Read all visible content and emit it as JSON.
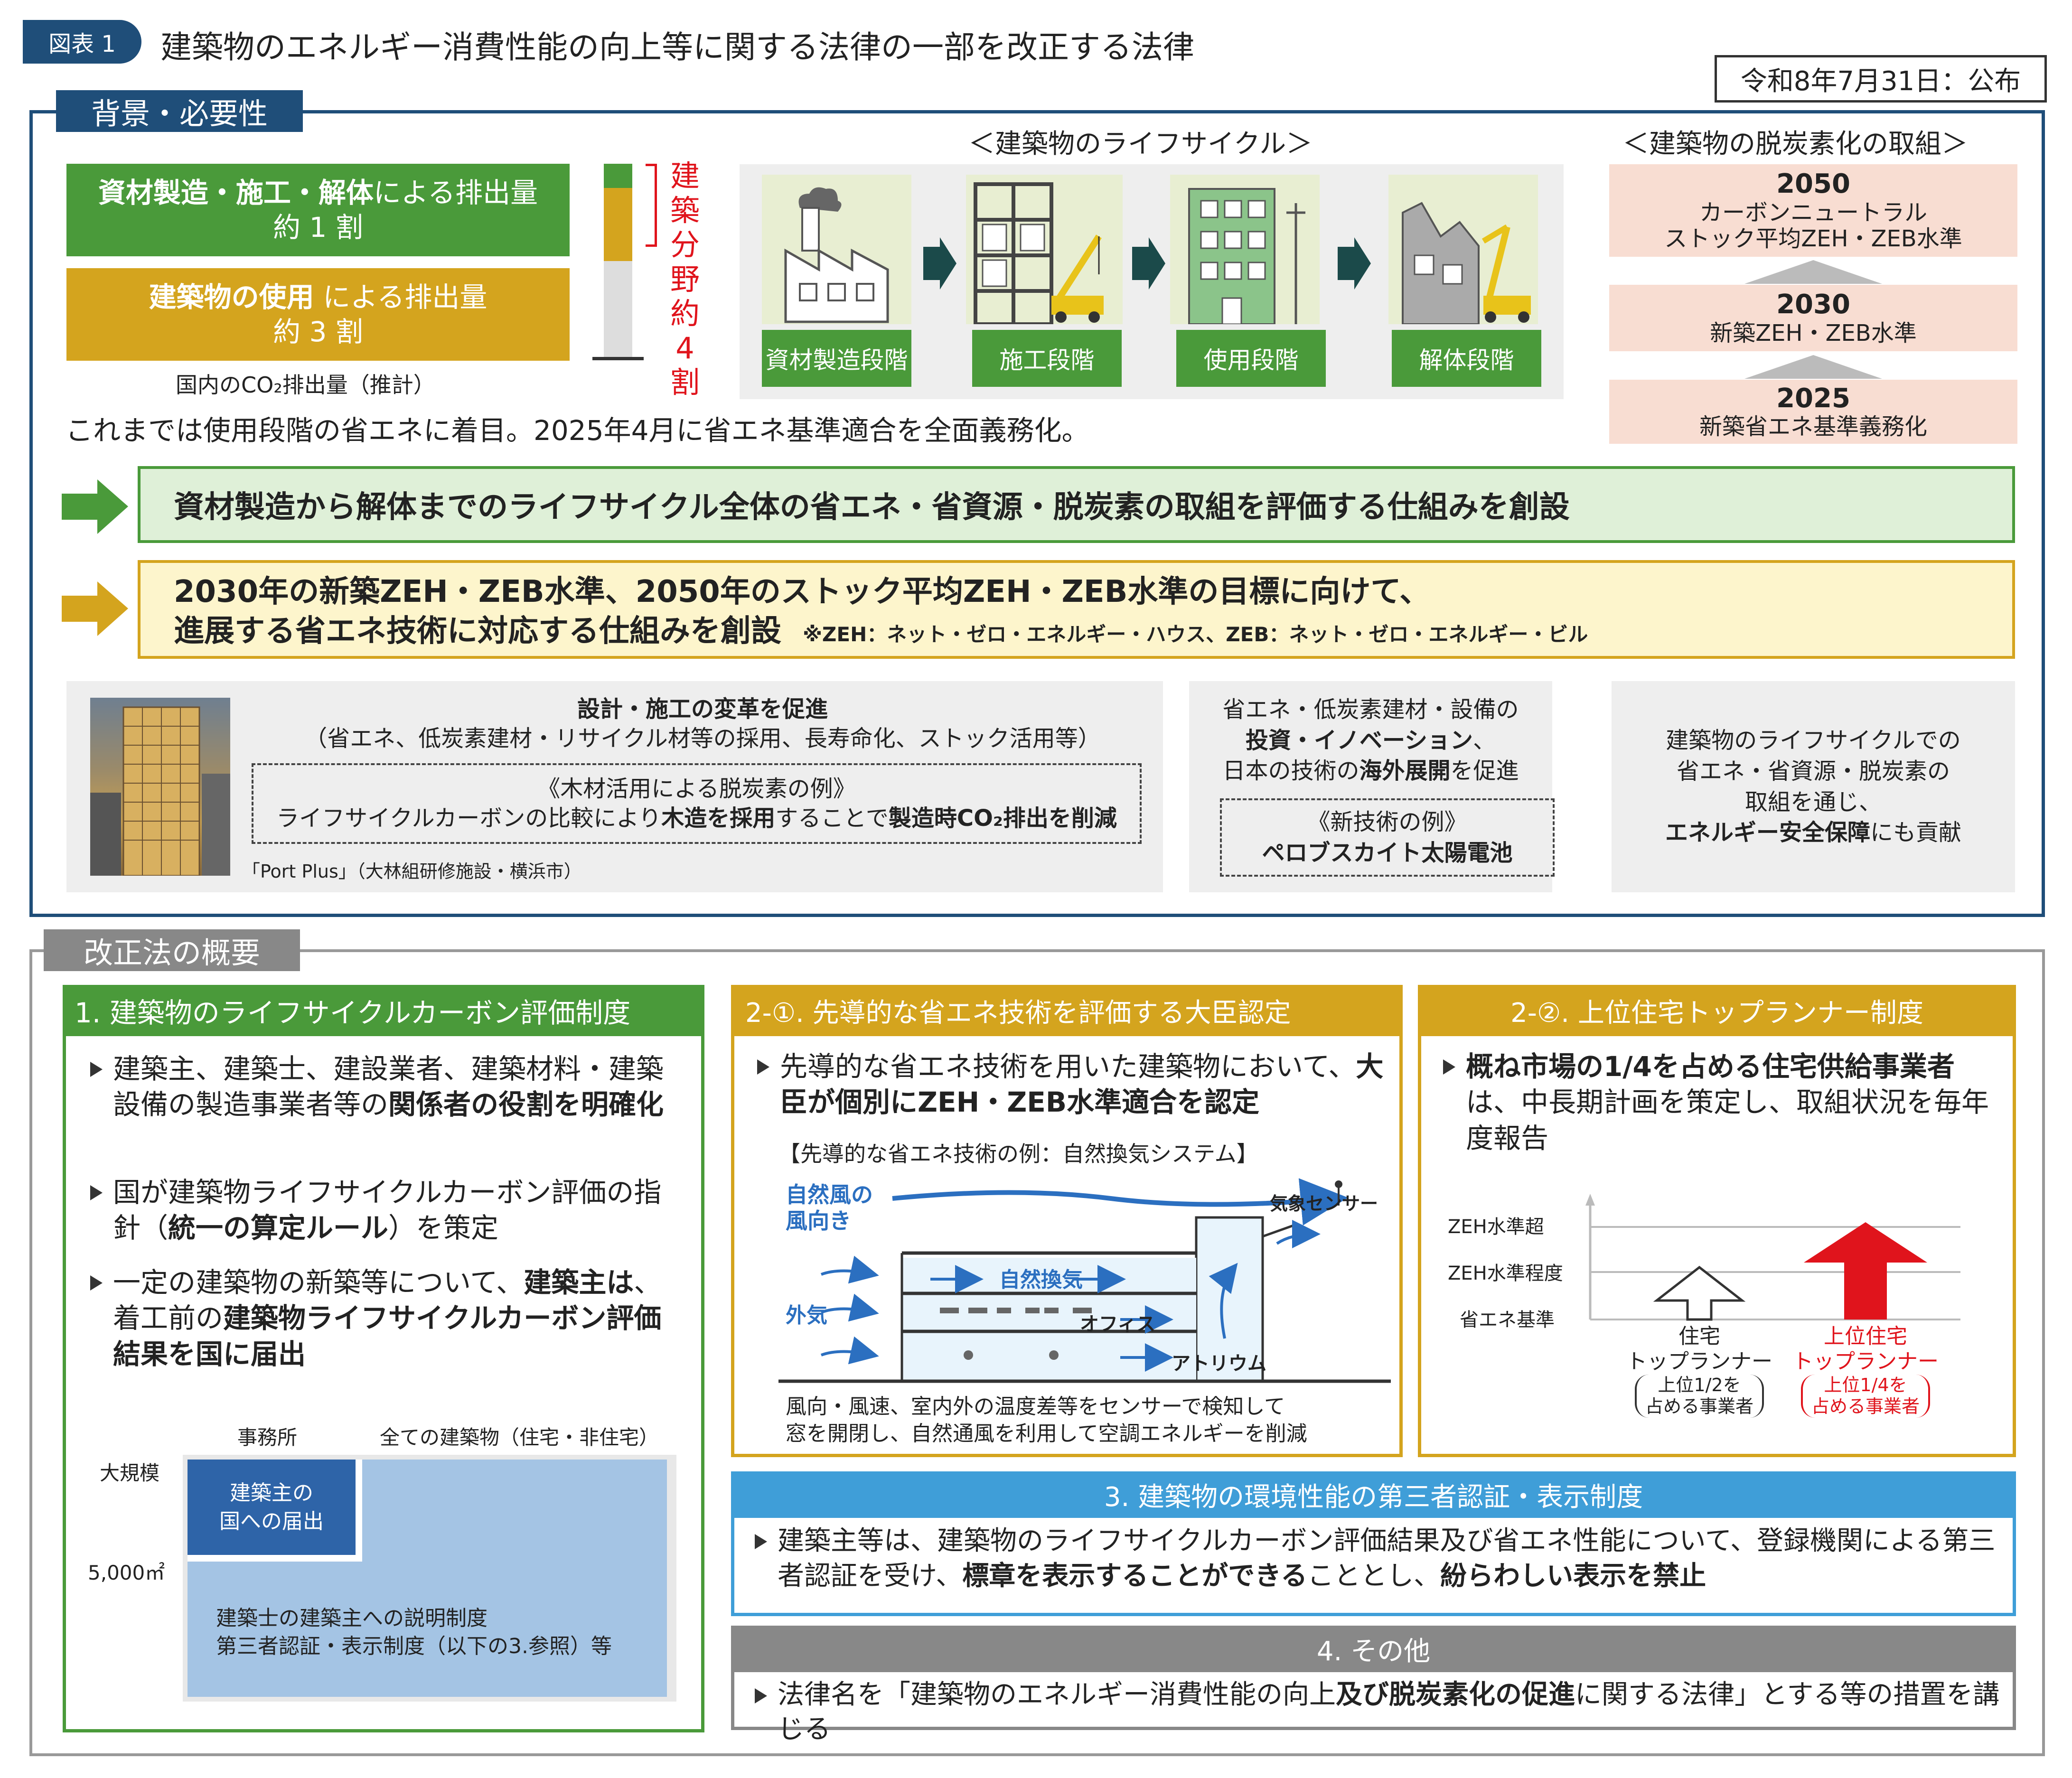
{
  "header": {
    "badge": "図表 1",
    "title": "建築物のエネルギー消費性能の向上等に関する法律の一部を改正する法律",
    "date": "令和8年7月31日：公布"
  },
  "background": {
    "section_label": "背景・必要性",
    "emission_1_a": "資材製造・施工・解体",
    "emission_1_b": "による排出量",
    "emission_1_c": "約 1 割",
    "emission_2_a": "建築物の使用",
    "emission_2_b": " による排出量",
    "emission_2_c": "約 3 割",
    "bar_caption": "国内のCO₂排出量（推計）",
    "vertical_label": "建築分野約4割",
    "bar_segments": {
      "green": 0.1,
      "yellow": 0.3
    },
    "lifecycle_title": "＜建築物のライフサイクル＞",
    "lifecycle_stages": [
      "資材製造段階",
      "施工段階",
      "使用段階",
      "解体段階"
    ],
    "decarb_title": "＜建築物の脱炭素化の取組＞",
    "decarb_2050_year": "2050",
    "decarb_2050_l1": "カーボンニュートラル",
    "decarb_2050_l2": "ストック平均ZEH・ZEB水準",
    "decarb_2030_year": "2030",
    "decarb_2030_l1": "新築ZEH・ZEB水準",
    "decarb_2025_year": "2025",
    "decarb_2025_l1": "新築省エネ基準義務化",
    "note": "これまでは使用段階の省エネに着目。2025年4月に省エネ基準適合を全面義務化。",
    "green_box": "資材製造から解体までのライフサイクル全体の省エネ・省資源・脱炭素の取組を評価する仕組みを創設",
    "yellow_box_l1": "2030年の新築ZEH・ZEB水準、2050年のストック平均ZEH・ZEB水準の目標に向けて、",
    "yellow_box_l2": "進展する省エネ技術に対応する仕組みを創設",
    "yellow_box_note": "※ZEH：ネット・ゼロ・エネルギー・ハウス、ZEB：ネット・ゼロ・エネルギー・ビル",
    "info1_title": "設計・施工の変革を促進",
    "info1_sub": "（省エネ、低炭素建材・リサイクル材等の採用、長寿命化、ストック活用等）",
    "info1_box_title": "《木材活用による脱炭素の例》",
    "info1_box_a": "ライフサイクルカーボンの比較により",
    "info1_box_b": "木造を採用",
    "info1_box_c": "することで",
    "info1_box_d": "製造時CO₂排出を削減",
    "photo_caption": "「Port Plus」（大林組研修施設・横浜市）",
    "info2_l1": "省エネ・低炭素建材・設備の",
    "info2_l2a": "投資・イノベーション",
    "info2_l2b": "、",
    "info2_l3a": "日本の技術の",
    "info2_l3b": "海外展開",
    "info2_l3c": "を促進",
    "info2_box_title": "《新技術の例》",
    "info2_box_body": "ペロブスカイト太陽電池",
    "info3_l1": "建築物のライフサイクルでの",
    "info3_l2": "省エネ・省資源・脱炭素の",
    "info3_l3": "取組を通じ、",
    "info3_l4a": "エネルギー安全保障",
    "info3_l4b": "にも貢献"
  },
  "overview": {
    "section_label": "改正法の概要",
    "s1_title": "1. 建築物のライフサイクルカーボン評価制度",
    "s1_b1_a": "建築主、建築士、建設業者、建築材料・建築設備の製造事業者等の",
    "s1_b1_b": "関係者の役割を明確化",
    "s1_b2_a": "国が建築物ライフサイクルカーボン評価の指針（",
    "s1_b2_b": "統一の算定ルール",
    "s1_b2_c": "）を策定",
    "s1_b3_a": "一定の建築物の新築等について、",
    "s1_b3_b": "建築主は",
    "s1_b3_c": "、着工前の",
    "s1_b3_d": "建築物ライフサイクルカーボン評価結果を国に届出",
    "s1_chart_col1": "事務所",
    "s1_chart_col2": "全ての建築物（住宅・非住宅）",
    "s1_chart_row1": "大規模",
    "s1_chart_row2": "5,000㎡",
    "s1_chart_dark_l1": "建築主の",
    "s1_chart_dark_l2": "国への届出",
    "s1_chart_light_l1": "建築士の建築主への説明制度",
    "s1_chart_light_l2": "第三者認証・表示制度（以下の3.参照）等",
    "s21_title": "2-①. 先導的な省エネ技術を評価する大臣認定",
    "s21_b1_a": "先導的な省エネ技術を用いた建築物において、",
    "s21_b1_b": "大臣が個別にZEH・ZEB水準適合を認定",
    "s21_example": "【先導的な省エネ技術の例：自然換気システム】",
    "s21_wind_l1": "自然風の",
    "s21_wind_l2": "風向き",
    "s21_sensor": "気象センサー",
    "s21_natural": "自然換気",
    "s21_outside": "外気",
    "s21_office": "オフィス",
    "s21_atrium": "アトリウム",
    "s21_caption_l1": "風向・風速、室内外の温度差等をセンサーで検知して",
    "s21_caption_l2": "窓を開閉し、自然通風を利用して空調エネルギーを削減",
    "s22_title": "2-②. 上位住宅トップランナー制度",
    "s22_b1_a": "概ね市場の1/4を占める住宅供給事業者",
    "s22_b1_b": "は、中長期計画を策定し、取組状況を毎年度報告",
    "s22_lvl1": "ZEH水準超",
    "s22_lvl2": "ZEH水準程度",
    "s22_lvl3": "省エネ基準",
    "s22_arrow1_l1": "住宅",
    "s22_arrow1_l2": "トップランナー",
    "s22_arrow1_l3": "上位1/2を",
    "s22_arrow1_l4": "占める事業者",
    "s22_arrow2_l1": "上位住宅",
    "s22_arrow2_l2": "トップランナー",
    "s22_arrow2_l3": "上位1/4を",
    "s22_arrow2_l4": "占める事業者",
    "s3_title": "3. 建築物の環境性能の第三者認証・表示制度",
    "s3_b1_a": "建築主等は、建築物のライフサイクルカーボン評価結果及び省エネ性能について、登録機関による第三者認証を受け、",
    "s3_b1_b": "標章を表示することができる",
    "s3_b1_c": "こととし、",
    "s3_b1_d": "紛らわしい表示を禁止",
    "s4_title": "4. その他",
    "s4_b1_a": "法律名を「建築物のエネルギー消費性能の向上",
    "s4_b1_b": "及び脱炭素化の促進",
    "s4_b1_c": "に関する法律」とする等の措置を講じる"
  },
  "colors": {
    "navy": "#1f4e79",
    "green": "#4a9a3a",
    "gold": "#d4a41e",
    "sky": "#3f9ed8",
    "gray": "#888888",
    "red": "#e0141c",
    "peach": "#f8ddd2"
  }
}
